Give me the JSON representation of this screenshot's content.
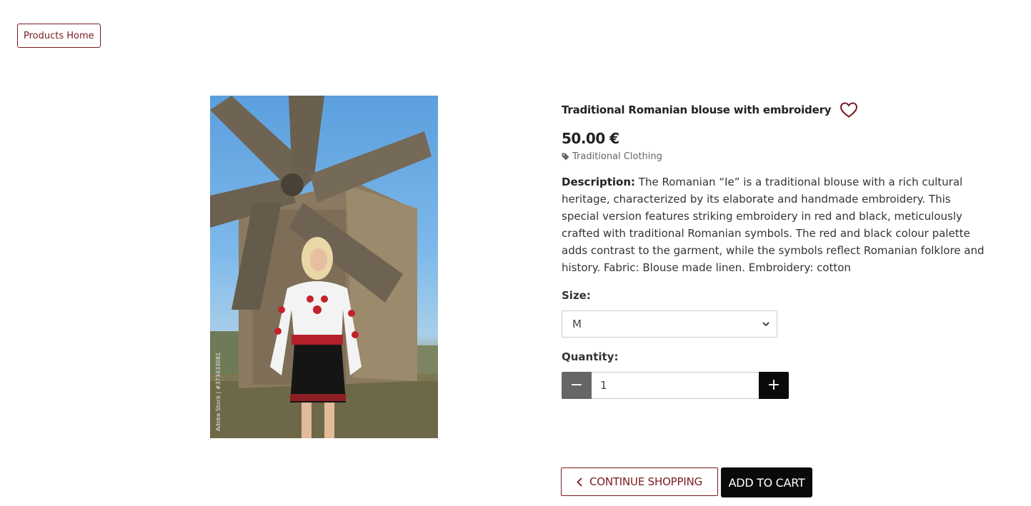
{
  "nav": {
    "home_label": "Products Home"
  },
  "product": {
    "title": "Traditional Romanian blouse with embroidery",
    "price": "50.00 €",
    "category": "Traditional Clothing",
    "description_label": "Description:",
    "description": " The Romanian “Ie” is a traditional blouse with a rich cultural heritage, characterized by its elaborate and handmade embroidery. This special version features striking embroidery in red and black, meticulously crafted with traditional Romanian symbols. The red and black colour palette adds contrast to the garment, while the symbols reflect Romanian folklore and history. Fabric: Blouse made linen. Embroidery: cotton",
    "image_watermark": "Adobe Stock | #373433081"
  },
  "options": {
    "size_label": "Size:",
    "size_value": "M",
    "quantity_label": "Quantity:",
    "quantity_value": "1",
    "minus_symbol": "−",
    "plus_symbol": "+"
  },
  "actions": {
    "continue_label": "CONTINUE SHOPPING",
    "add_to_cart_label": "ADD TO CART"
  },
  "colors": {
    "accent": "#7a1a1f",
    "dark": "#0a0a0a"
  }
}
